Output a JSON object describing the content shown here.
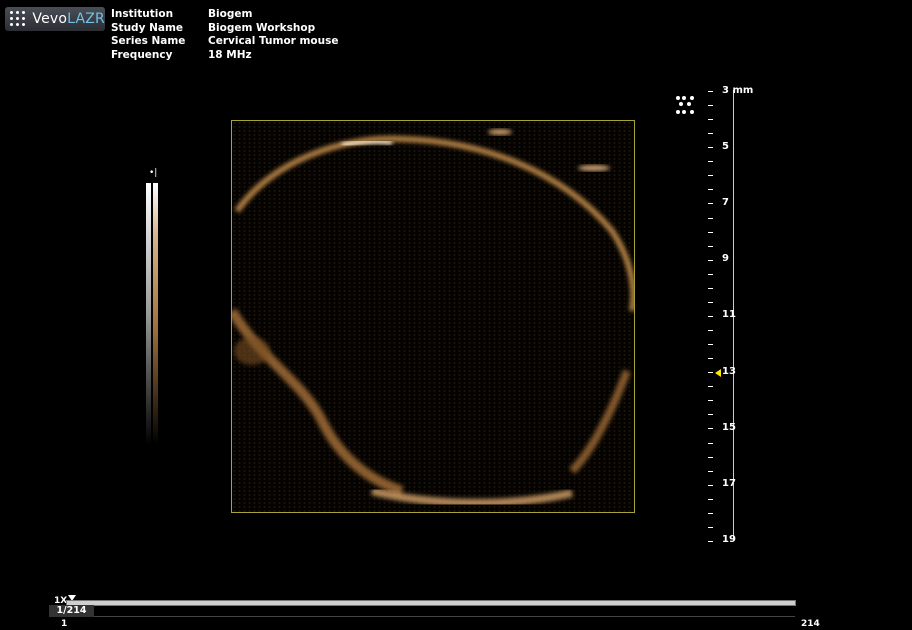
{
  "app": {
    "brand_prefix": "Vevo",
    "brand_suffix": "LAZR"
  },
  "info": [
    {
      "key": "Institution",
      "value": "Biogem"
    },
    {
      "key": "Study Name",
      "value": "Biogem Workshop"
    },
    {
      "key": "Series Name",
      "value": "Cervical Tumor mouse"
    },
    {
      "key": "Frequency",
      "value": "18 MHz"
    }
  ],
  "colorbar": {
    "marker": "•|"
  },
  "depth_scale": {
    "unit": "mm",
    "labels": [
      "3 mm",
      "5",
      "7",
      "9",
      "11",
      "13",
      "15",
      "17",
      "19"
    ],
    "focus_marker_value": 13
  },
  "timeline": {
    "zoom": "1X",
    "frame": "1/214",
    "start": "1",
    "end": "214"
  },
  "colors": {
    "accent_roi": "#a7a334",
    "focus_pointer": "#ffe600",
    "brand_blue": "#6fc3e8"
  },
  "icons": [
    "vevo-logo-icon",
    "probe-orientation-icon",
    "playhead-icon",
    "focus-pointer-icon"
  ]
}
